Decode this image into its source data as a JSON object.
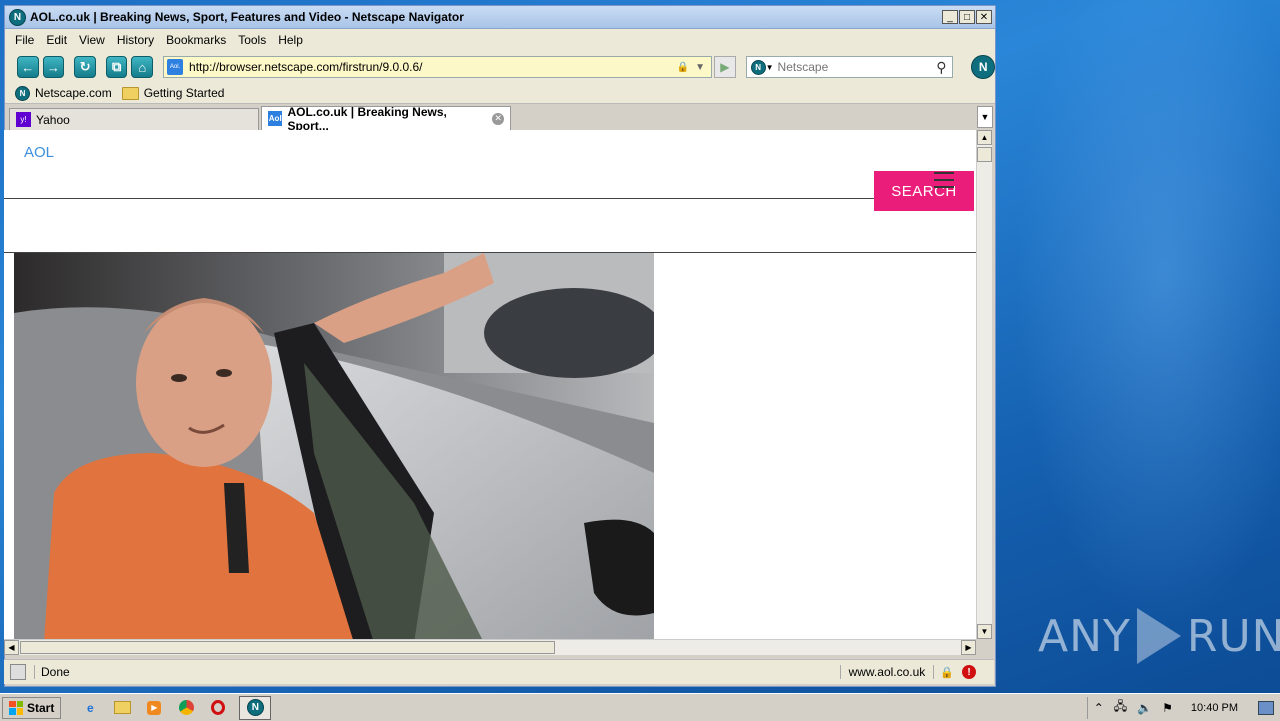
{
  "window": {
    "title": "AOL.co.uk | Breaking News, Sport, Features and Video - Netscape Navigator",
    "buttons": {
      "minimize": "_",
      "maximize": "□",
      "close": "✕"
    }
  },
  "menu": [
    "File",
    "Edit",
    "View",
    "History",
    "Bookmarks",
    "Tools",
    "Help"
  ],
  "toolbar": {
    "url": "http://browser.netscape.com/firstrun/9.0.0.6/",
    "search_placeholder": "Netscape",
    "favicon_text": "Aol."
  },
  "bookmarks": [
    {
      "label": "Netscape.com",
      "icon": "netscape-icon"
    },
    {
      "label": "Getting Started",
      "icon": "folder-icon"
    }
  ],
  "tabs": [
    {
      "label": "Yahoo",
      "active": false
    },
    {
      "label": "AOL.co.uk | Breaking News, Sport...",
      "active": true
    }
  ],
  "page": {
    "logo": "AOL",
    "search_button": "SEARCH"
  },
  "status": {
    "text": "Done",
    "site": "www.aol.co.uk"
  },
  "taskbar": {
    "start": "Start",
    "clock": "10:40 PM"
  },
  "watermark": {
    "left": "ANY",
    "right": "RUN"
  },
  "colors": {
    "aol_blue": "#3d8fe0",
    "search_pink": "#ea1e7a",
    "url_bg": "#fdf8c8",
    "desktop_blue": "#1c6fc4"
  }
}
